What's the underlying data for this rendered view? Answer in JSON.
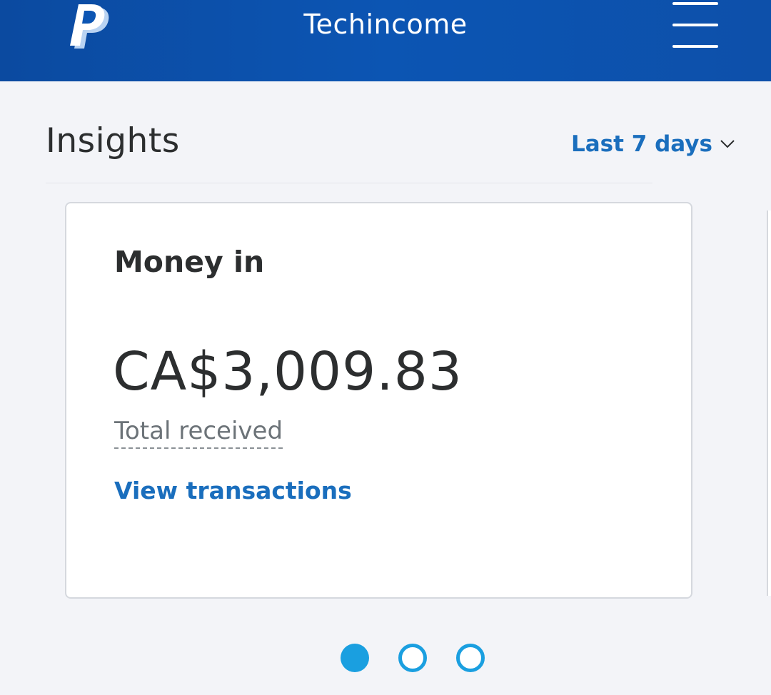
{
  "header": {
    "logo_icon": "paypal-logo-icon",
    "title": "Techincome",
    "menu_icon": "hamburger-menu-icon"
  },
  "insights": {
    "title": "Insights",
    "range_label": "Last 7 days",
    "range_icon": "chevron-down-icon"
  },
  "card": {
    "title": "Money in",
    "amount": "CA$3,009.83",
    "amount_label": "Total received",
    "link_label": "View transactions"
  },
  "carousel": {
    "page_count": 3,
    "active_index": 0
  },
  "colors": {
    "header_bg": "#0c55b3",
    "accent_link": "#1a6ebd",
    "dot_active": "#1a9fe0",
    "page_bg": "#f3f4f8"
  }
}
